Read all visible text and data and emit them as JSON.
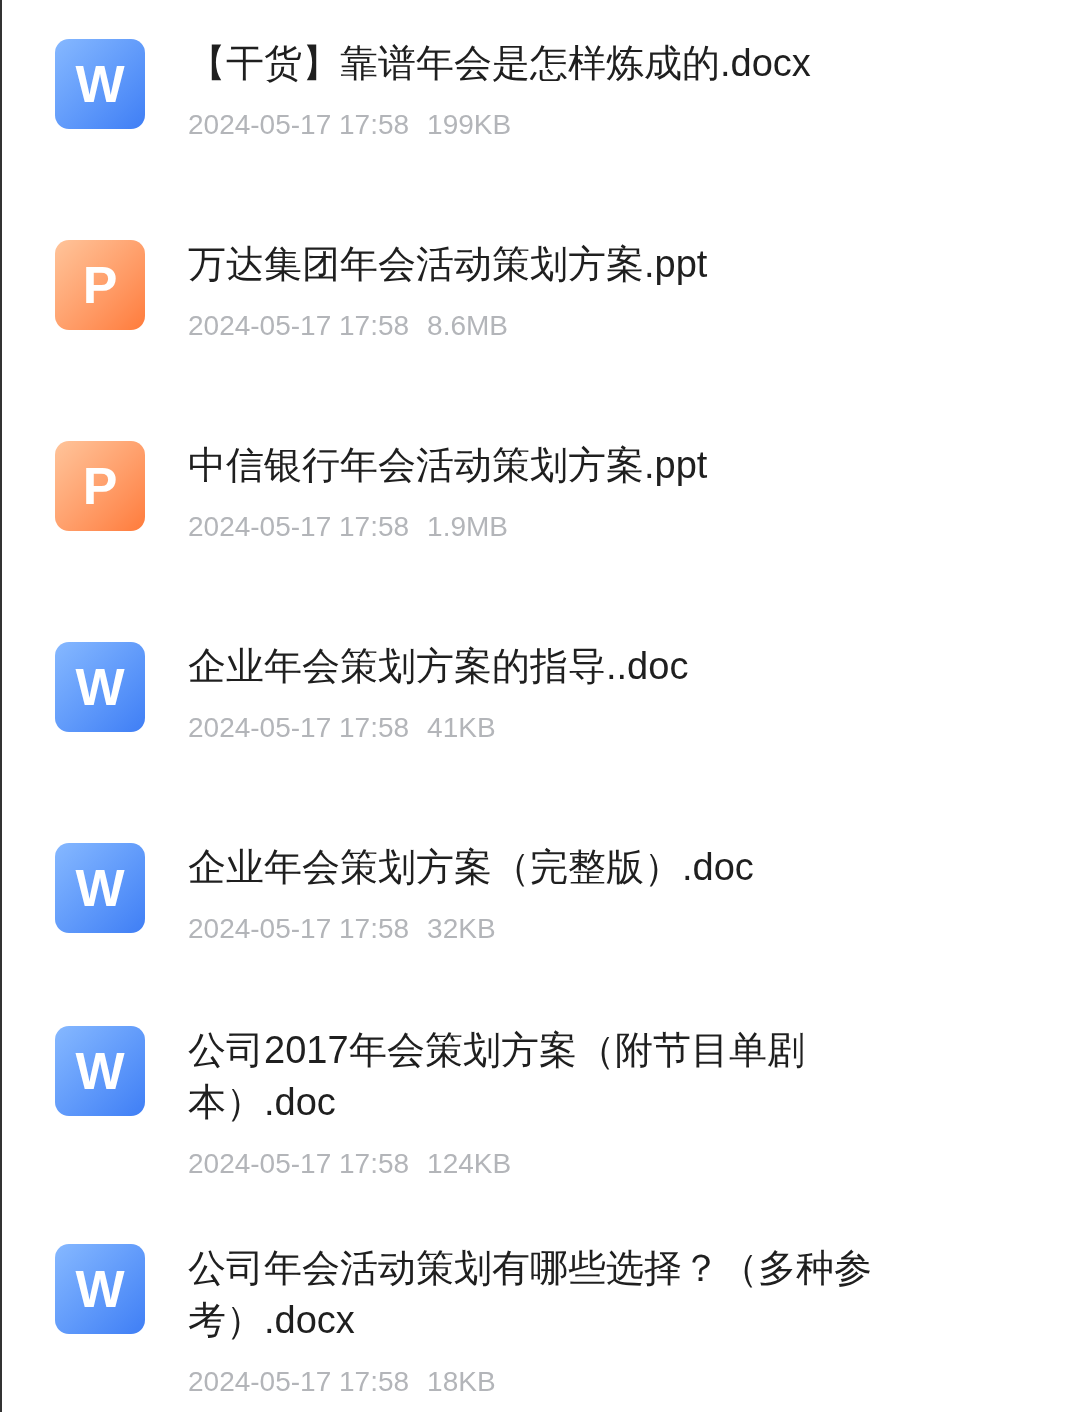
{
  "files": [
    {
      "kind": "word",
      "letter": "W",
      "title_lines": [
        "【干货】靠谱年会是怎样炼成的.docx"
      ],
      "date": "2024-05-17 17:58",
      "size": "199KB"
    },
    {
      "kind": "ppt",
      "letter": "P",
      "title_lines": [
        "万达集团年会活动策划方案.ppt"
      ],
      "date": "2024-05-17 17:58",
      "size": "8.6MB"
    },
    {
      "kind": "ppt",
      "letter": "P",
      "title_lines": [
        "中信银行年会活动策划方案.ppt"
      ],
      "date": "2024-05-17 17:58",
      "size": "1.9MB"
    },
    {
      "kind": "word",
      "letter": "W",
      "title_lines": [
        "企业年会策划方案的指导..doc"
      ],
      "date": "2024-05-17 17:58",
      "size": "41KB"
    },
    {
      "kind": "word",
      "letter": "W",
      "title_lines": [
        "企业年会策划方案（完整版）.doc"
      ],
      "date": "2024-05-17 17:58",
      "size": "32KB"
    },
    {
      "kind": "word",
      "letter": "W",
      "title_lines": [
        "公司2017年会策划方案（附节目单剧",
        "本）.doc"
      ],
      "date": "2024-05-17 17:58",
      "size": "124KB"
    },
    {
      "kind": "word",
      "letter": "W",
      "title_lines": [
        "公司年会活动策划有哪些选择？（多种参",
        "考）.docx"
      ],
      "date": "2024-05-17 17:58",
      "size": "18KB"
    }
  ]
}
